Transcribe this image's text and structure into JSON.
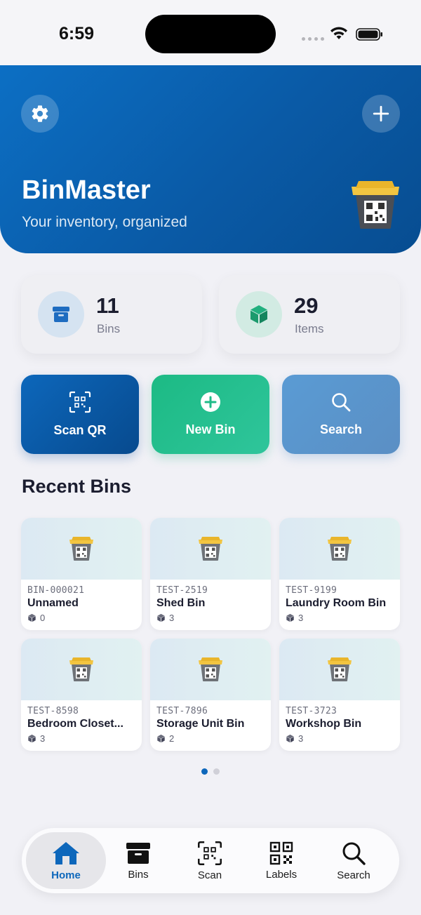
{
  "status": {
    "time": "6:59"
  },
  "header": {
    "title": "BinMaster",
    "subtitle": "Your inventory, organized"
  },
  "stats": [
    {
      "value": "11",
      "label": "Bins"
    },
    {
      "value": "29",
      "label": "Items"
    }
  ],
  "actions": [
    {
      "label": "Scan QR"
    },
    {
      "label": "New Bin"
    },
    {
      "label": "Search"
    }
  ],
  "recent": {
    "title": "Recent Bins",
    "bins": [
      {
        "id": "BIN-000021",
        "name": "Unnamed",
        "count": "0"
      },
      {
        "id": "TEST-2519",
        "name": "Shed Bin",
        "count": "3"
      },
      {
        "id": "TEST-9199",
        "name": "Laundry Room Bin",
        "count": "3"
      },
      {
        "id": "TEST-8598",
        "name": "Bedroom Closet...",
        "count": "3"
      },
      {
        "id": "TEST-7896",
        "name": "Storage Unit Bin",
        "count": "2"
      },
      {
        "id": "TEST-3723",
        "name": "Workshop Bin",
        "count": "3"
      }
    ]
  },
  "pager": {
    "current": 1,
    "total": 2
  },
  "tabs": [
    {
      "label": "Home",
      "active": true
    },
    {
      "label": "Bins"
    },
    {
      "label": "Scan"
    },
    {
      "label": "Labels"
    },
    {
      "label": "Search"
    }
  ],
  "colors": {
    "primary": "#0d67bb",
    "green": "#1cba84",
    "light_blue": "#5a9bd4",
    "background": "#f1f1f6"
  }
}
